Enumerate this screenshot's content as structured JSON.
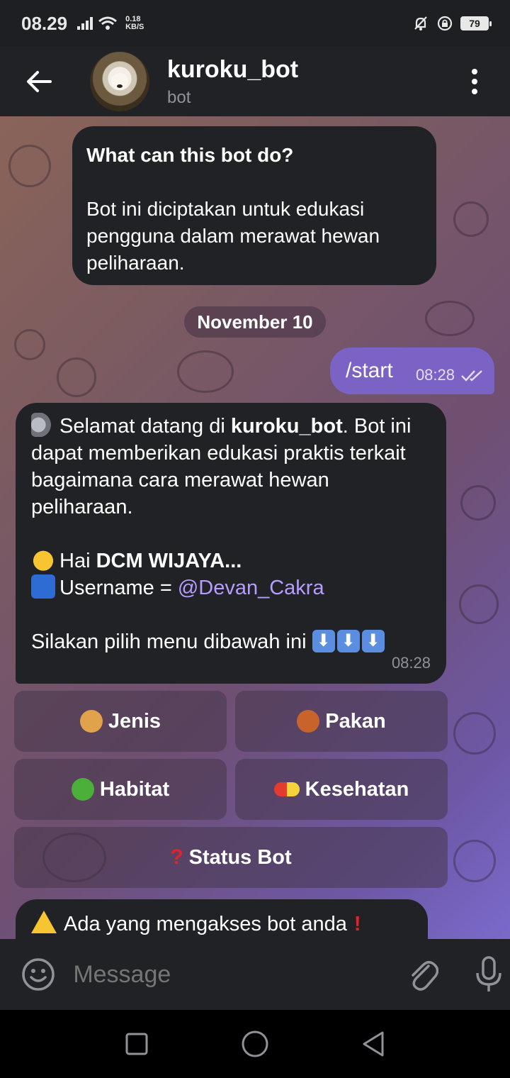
{
  "status": {
    "time": "08.29",
    "net_speed_value": "0.18",
    "net_speed_unit": "KB/S",
    "battery": "79"
  },
  "header": {
    "title": "kuroku_bot",
    "subtitle": "bot"
  },
  "intro": {
    "title": "What can this bot do?",
    "body": "Bot ini diciptakan untuk edukasi pengguna dalam merawat hewan peliharaan."
  },
  "date_chip": "November 10",
  "start_message": {
    "text": "/start",
    "time": "08:28"
  },
  "welcome": {
    "line1_a": "Selamat datang di ",
    "line1_bold": "kuroku_bot",
    "line1_b": ". Bot ini dapat memberikan edukasi praktis terkait bagaimana cara merawat hewan peliharaan.",
    "greet_a": "Hai ",
    "greet_bold": "DCM WIJAYA...",
    "username_label": "Username = ",
    "username": "@Devan_Cakra",
    "menu_prompt": "Silakan pilih menu dibawah ini ",
    "time": "08:28"
  },
  "keyboard": {
    "jenis": "Jenis",
    "pakan": "Pakan",
    "habitat": "Habitat",
    "kesehatan": "Kesehatan",
    "status": "Status Bot"
  },
  "alert": {
    "text": "Ada yang mengakses bot anda"
  },
  "composer": {
    "placeholder": "Message"
  },
  "colors": {
    "bubble_in": "#212226",
    "bubble_out": "#7b63c6",
    "mention": "#b79cff",
    "header": "#212226"
  }
}
